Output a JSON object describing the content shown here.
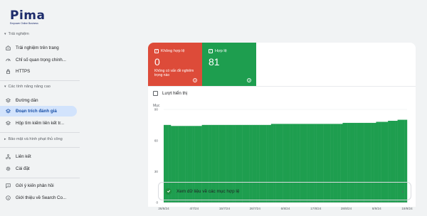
{
  "logo": {
    "brand": "Pima",
    "tagline": "Empower Online Business"
  },
  "sidebar": {
    "sections": [
      {
        "label": "Trải nghiệm"
      },
      {
        "label": "Các tính năng nâng cao"
      },
      {
        "label": "Bảo mật và hình phạt thủ công"
      }
    ],
    "items": [
      {
        "label": "Trải nghiệm trên trang",
        "icon": "page-experience-icon"
      },
      {
        "label": "Chỉ số quan trọng chính...",
        "icon": "core-web-vitals-icon"
      },
      {
        "label": "HTTPS",
        "icon": "lock-icon"
      },
      {
        "label": "Đường dẫn",
        "icon": "breadcrumbs-icon"
      },
      {
        "label": "Đoạn trích đánh giá",
        "icon": "review-snippets-icon"
      },
      {
        "label": "Hộp tìm kiếm liên kết tr...",
        "icon": "sitelinks-searchbox-icon"
      },
      {
        "label": "Liên kết",
        "icon": "links-icon"
      },
      {
        "label": "Cài đặt",
        "icon": "settings-icon"
      },
      {
        "label": "Gửi ý kiến phản hồi",
        "icon": "feedback-icon"
      },
      {
        "label": "Giới thiệu về Search Co...",
        "icon": "info-icon"
      }
    ]
  },
  "summary": {
    "invalid": {
      "label": "Không hợp lệ",
      "value": "0",
      "subtitle": "Không có vấn đề nghiêm trọng nào",
      "color": "#dd4b39"
    },
    "valid": {
      "label": "Hợp lệ",
      "value": "81",
      "color": "#1e9e4f"
    }
  },
  "impressions_toggle": {
    "label": "Lượt hiển thị"
  },
  "chart_data": {
    "type": "bar",
    "ylabel": "Mục",
    "ylim": [
      0,
      90
    ],
    "yticks": [
      0,
      30,
      60,
      90
    ],
    "xtick_labels": [
      "26/6/24",
      "4/7/24",
      "15/7/24",
      "26/7/24",
      "6/8/24",
      "17/8/24",
      "28/8/24",
      "8/9/24",
      "19/9/24"
    ],
    "series": [
      {
        "color": "#1e9e4f",
        "values": [
          75,
          75,
          75,
          74,
          74,
          74,
          74,
          74,
          74,
          74,
          74,
          74,
          74,
          74,
          74,
          74,
          75,
          75,
          75,
          75,
          75,
          75,
          75,
          75,
          75,
          75,
          75,
          75,
          75,
          75,
          75,
          75,
          75,
          75,
          75,
          75,
          75,
          75,
          75,
          75,
          75,
          75,
          75,
          75,
          75,
          76,
          76,
          76,
          76,
          76,
          76,
          76,
          76,
          76,
          76,
          76,
          76,
          76,
          76,
          76,
          76,
          76,
          76,
          76,
          76,
          76,
          76,
          76,
          76,
          76,
          76,
          76,
          76,
          76,
          76,
          77,
          77,
          77,
          77,
          77,
          77,
          77,
          77,
          77,
          77,
          77,
          77,
          77,
          77,
          78,
          78,
          78,
          78,
          78,
          79,
          79,
          79,
          79,
          80,
          80,
          80,
          80
        ]
      }
    ]
  },
  "footer_link": {
    "label": "Xem dữ liệu về các mục hợp lệ"
  }
}
